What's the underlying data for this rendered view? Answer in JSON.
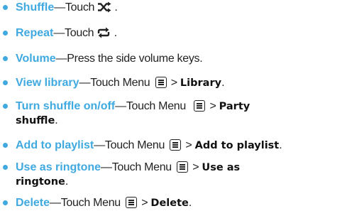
{
  "items": [
    {
      "term": "Shuffle",
      "dash": "—Touch",
      "after": " ."
    },
    {
      "term": "Repeat",
      "dash": "—Touch",
      "after": " ."
    },
    {
      "term": "Volume",
      "text": "—Press the side volume keys."
    },
    {
      "term": "View library",
      "pre": "—Touch Menu",
      "sep": ">",
      "bold": "Library",
      "end": "."
    },
    {
      "term": "Turn shuffle on/off",
      "pre": "—Touch Menu",
      "sep": ">",
      "bold1": "Party",
      "bold2": "shuffle",
      "end": "."
    },
    {
      "term": "Add to playlist",
      "pre": "—Touch Menu",
      "sep": ">",
      "bold": "Add to playlist",
      "end": "."
    },
    {
      "term": "Use as ringtone",
      "pre": "—Touch Menu",
      "sep": ">",
      "bold1": "Use as",
      "bold2": "ringtone",
      "end": "."
    },
    {
      "term": "Delete",
      "pre": "—Touch Menu",
      "sep": ">",
      "bold": "Delete",
      "end": "."
    }
  ],
  "icons": {
    "shuffle": "shuffle-icon",
    "repeat": "repeat-icon",
    "menu": "menu-key-icon"
  },
  "colors": {
    "accent": "#3fa9e0",
    "text": "#222222"
  }
}
